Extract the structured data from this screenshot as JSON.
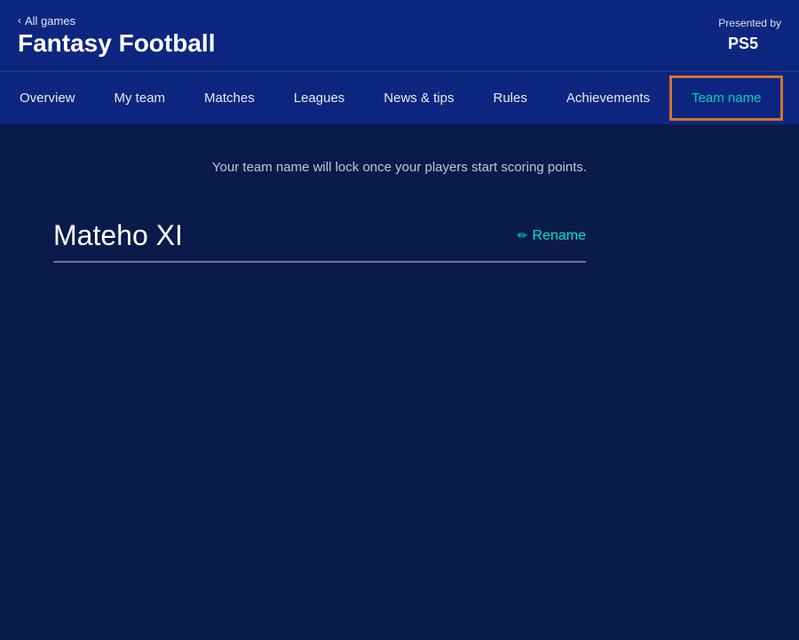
{
  "header": {
    "back_label": "All games",
    "app_title": "Fantasy Football",
    "presented_by": "Presented by",
    "ps5_label": "PS5"
  },
  "nav": {
    "items": [
      {
        "id": "overview",
        "label": "Overview",
        "active": false
      },
      {
        "id": "my-team",
        "label": "My team",
        "active": false
      },
      {
        "id": "matches",
        "label": "Matches",
        "active": false
      },
      {
        "id": "leagues",
        "label": "Leagues",
        "active": false
      },
      {
        "id": "news-tips",
        "label": "News & tips",
        "active": false
      },
      {
        "id": "rules",
        "label": "Rules",
        "active": false
      },
      {
        "id": "achievements",
        "label": "Achievements",
        "active": false
      },
      {
        "id": "team-name",
        "label": "Team name",
        "active": true
      }
    ]
  },
  "main": {
    "subtitle": "Your team name will lock once your players start scoring points.",
    "team_name": "Mateho XI",
    "rename_label": "Rename"
  }
}
